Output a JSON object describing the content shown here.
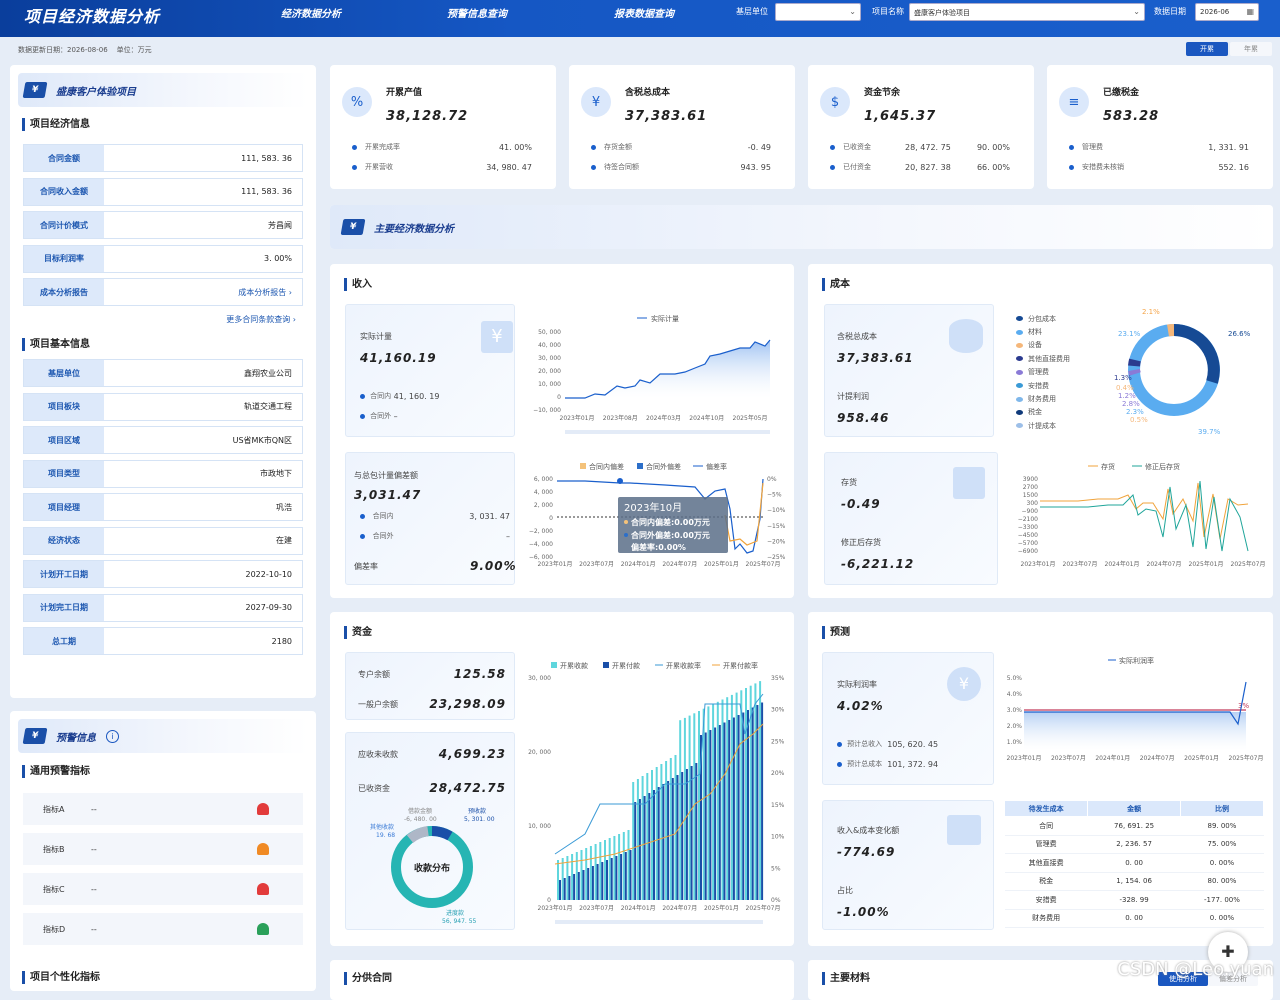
{
  "header": {
    "title": "项目经济数据分析",
    "nav": [
      "经济数据分析",
      "预警信息查询",
      "报表数据查询"
    ],
    "filters": {
      "unit_label": "基层单位",
      "unit_value": "",
      "project_label": "项目名称",
      "project_value": "盛康客户体验项目",
      "date_label": "数据日期",
      "date_value": "2026-06"
    }
  },
  "subbar": {
    "update_label": "数据更新日期：2026-08-06",
    "unit": "单位：万元",
    "toggle_on": "开累",
    "toggle_off": "年累"
  },
  "left": {
    "project_name": "盛康客户体验项目",
    "econ_title": "项目经济信息",
    "econ": [
      {
        "k": "合同金额",
        "v": "111, 583. 36"
      },
      {
        "k": "合同收入金额",
        "v": "111, 583. 36"
      },
      {
        "k": "合同计价模式",
        "v": "芳昌闻"
      },
      {
        "k": "目标利润率",
        "v": "3. 00%"
      },
      {
        "k": "成本分析报告",
        "v": "成本分析报告 ›"
      }
    ],
    "more_link": "更多合同条款查询 ›",
    "basic_title": "项目基本信息",
    "basic": [
      {
        "k": "基层单位",
        "v": "鑫翔农业公司"
      },
      {
        "k": "项目板块",
        "v": "轨道交通工程"
      },
      {
        "k": "项目区域",
        "v": "US省MK市QN区"
      },
      {
        "k": "项目类型",
        "v": "市政地下"
      },
      {
        "k": "项目经理",
        "v": "巩浩"
      },
      {
        "k": "经济状态",
        "v": "在建"
      },
      {
        "k": "计划开工日期",
        "v": "2022-10-10"
      },
      {
        "k": "计划完工日期",
        "v": "2027-09-30"
      },
      {
        "k": "总工期",
        "v": "2180"
      }
    ],
    "warn_header": "预警信息",
    "warn_title": "通用预警指标",
    "warn": [
      {
        "k": "指标A",
        "v": "--",
        "color": "#e23b3b"
      },
      {
        "k": "指标B",
        "v": "--",
        "color": "#f08a24"
      },
      {
        "k": "指标C",
        "v": "--",
        "color": "#e23b3b"
      },
      {
        "k": "指标D",
        "v": "--",
        "color": "#2aa05a"
      }
    ],
    "personal_title": "项目个性化指标"
  },
  "cards": [
    {
      "title": "开累产值",
      "value": "38,128.72",
      "rows": [
        {
          "k": "开累完成率",
          "v": "41. 00%"
        },
        {
          "k": "开累营收",
          "v": "34, 980. 47"
        }
      ],
      "icon": "%"
    },
    {
      "title": "含税总成本",
      "value": "37,383.61",
      "rows": [
        {
          "k": "存货金额",
          "v": "-0. 49"
        },
        {
          "k": "待签合同额",
          "v": "943. 95"
        }
      ],
      "icon": "¥"
    },
    {
      "title": "资金节余",
      "value": "1,645.37",
      "rows": [
        {
          "k": "已收资金",
          "v": "28, 472. 75",
          "p": "90. 00%"
        },
        {
          "k": "已付资金",
          "v": "20, 827. 38",
          "p": "66. 00%"
        }
      ],
      "icon": "$"
    },
    {
      "title": "已缴税金",
      "value": "583.28",
      "rows": [
        {
          "k": "管理费",
          "v": "1, 331. 91"
        },
        {
          "k": "安措费未核销",
          "v": "552. 16"
        }
      ],
      "icon": "≡"
    }
  ],
  "main_title": "主要经济数据分析",
  "income": {
    "title": "收入",
    "actual_label": "实际计量",
    "actual_value": "41,160.19",
    "in_label": "合同内",
    "in_value": "41, 160. 19",
    "out_label": "合同外",
    "out_value": "–",
    "legend": "实际计量",
    "dev_label": "与总包计量偏差额",
    "dev_value": "3,031.47",
    "dev_in_label": "合同内",
    "dev_in_value": "3, 031. 47",
    "dev_out_label": "合同外",
    "dev_out_value": "–",
    "rate_label": "偏差率",
    "rate_value": "9.00%",
    "dev_legend": [
      "合同内偏差",
      "合同外偏差",
      "偏差率"
    ],
    "tooltip": {
      "title": "2023年10月",
      "l1": "合同内偏差:0.00万元",
      "l2": "合同外偏差:0.00万元",
      "l3": "偏差率:0.00%"
    }
  },
  "cost": {
    "title": "成本",
    "total_label": "含税总成本",
    "total_value": "37,383.61",
    "prov_label": "计提利润",
    "prov_value": "958.46",
    "legend": [
      "分包成本",
      "材料",
      "设备",
      "其他直接费用",
      "管理费",
      "安措费",
      "财务费用",
      "税金",
      "计提成本"
    ],
    "pie_labels": [
      "2.1%",
      "23.1%",
      "26.6%",
      "1.3%",
      "0.4%",
      "1.2%",
      "2.8%",
      "2.3%",
      "0.5%",
      "39.7%"
    ],
    "stock_label": "存货",
    "stock_value": "-0.49",
    "adj_label": "修正后存货",
    "adj_value": "-6,221.12",
    "stock_legend": [
      "存货",
      "修正后存货"
    ]
  },
  "fund": {
    "title": "资金",
    "acct_label": "专户余额",
    "acct_value": "125.58",
    "gen_label": "一般户余额",
    "gen_value": "23,298.09",
    "recv_label": "应收未收款",
    "recv_value": "4,699.23",
    "got_label": "已收资金",
    "got_value": "28,472.75",
    "donut_center": "收款分布",
    "donut_labels": [
      "借款金额",
      "-6, 480. 00",
      "预收款",
      "5, 301. 00",
      "其他收款",
      "19. 68",
      "进度款",
      "56, 947. 55"
    ],
    "legend": [
      "开累收款",
      "开累付款",
      "开累收款率",
      "开累付款率"
    ]
  },
  "forecast": {
    "title": "预测",
    "rate_label": "实际利润率",
    "rate_value": "4.02%",
    "inc_label": "预计总收入",
    "inc_value": "105, 620. 45",
    "cost_label": "预计总成本",
    "cost_value": "101, 372. 94",
    "legend": "实际利润率",
    "mark": "3%",
    "chg_label": "收入&成本变化额",
    "chg_value": "-774.69",
    "ratio_label": "占比",
    "ratio_value": "-1.00%",
    "table_head": [
      "待发生成本",
      "金额",
      "比例"
    ],
    "table": [
      [
        "合同",
        "76, 691. 25",
        "89. 00%"
      ],
      [
        "管理费",
        "2, 236. 57",
        "75. 00%"
      ],
      [
        "其他直接费",
        "0. 00",
        "0. 00%"
      ],
      [
        "税金",
        "1, 154. 06",
        "80. 00%"
      ],
      [
        "安措费",
        "-328. 99",
        "-177. 00%"
      ],
      [
        "财务费用",
        "0. 00",
        "0. 00%"
      ]
    ]
  },
  "bottom": {
    "left": "分供合同",
    "right": "主要材料",
    "tab1": "使用分析",
    "tab2": "偏差分析"
  },
  "axes": {
    "income_y": [
      "50, 000",
      "40, 000",
      "30, 000",
      "20, 000",
      "10, 000",
      "0",
      "−10, 000"
    ],
    "income_x": [
      "2023年01月",
      "2023年08月",
      "2024年03月",
      "2024年10月",
      "2025年05月"
    ],
    "dev_y": [
      "6, 000",
      "4, 000",
      "2, 000",
      "0",
      "−2, 000",
      "−4, 000",
      "−6, 000"
    ],
    "dev_y2": [
      "0%",
      "−5%",
      "−10%",
      "−15%",
      "−20%",
      "−25%"
    ],
    "x6": [
      "2023年01月",
      "2023年07月",
      "2024年01月",
      "2024年07月",
      "2025年01月",
      "2025年07月"
    ],
    "stock_y": [
      "3900",
      "2700",
      "1500",
      "300",
      "−900",
      "−2100",
      "−3300",
      "−4500",
      "−5700",
      "−6900"
    ],
    "fund_y": [
      "30, 000",
      "20, 000",
      "10, 000",
      "0"
    ],
    "fund_y2": [
      "35%",
      "30%",
      "25%",
      "20%",
      "15%",
      "10%",
      "5%",
      "0%"
    ],
    "fc_y": [
      "5.0%",
      "4.0%",
      "3.0%",
      "2.0%",
      "1.0%"
    ]
  },
  "watermark": "CSDN @Leo.yuan"
}
